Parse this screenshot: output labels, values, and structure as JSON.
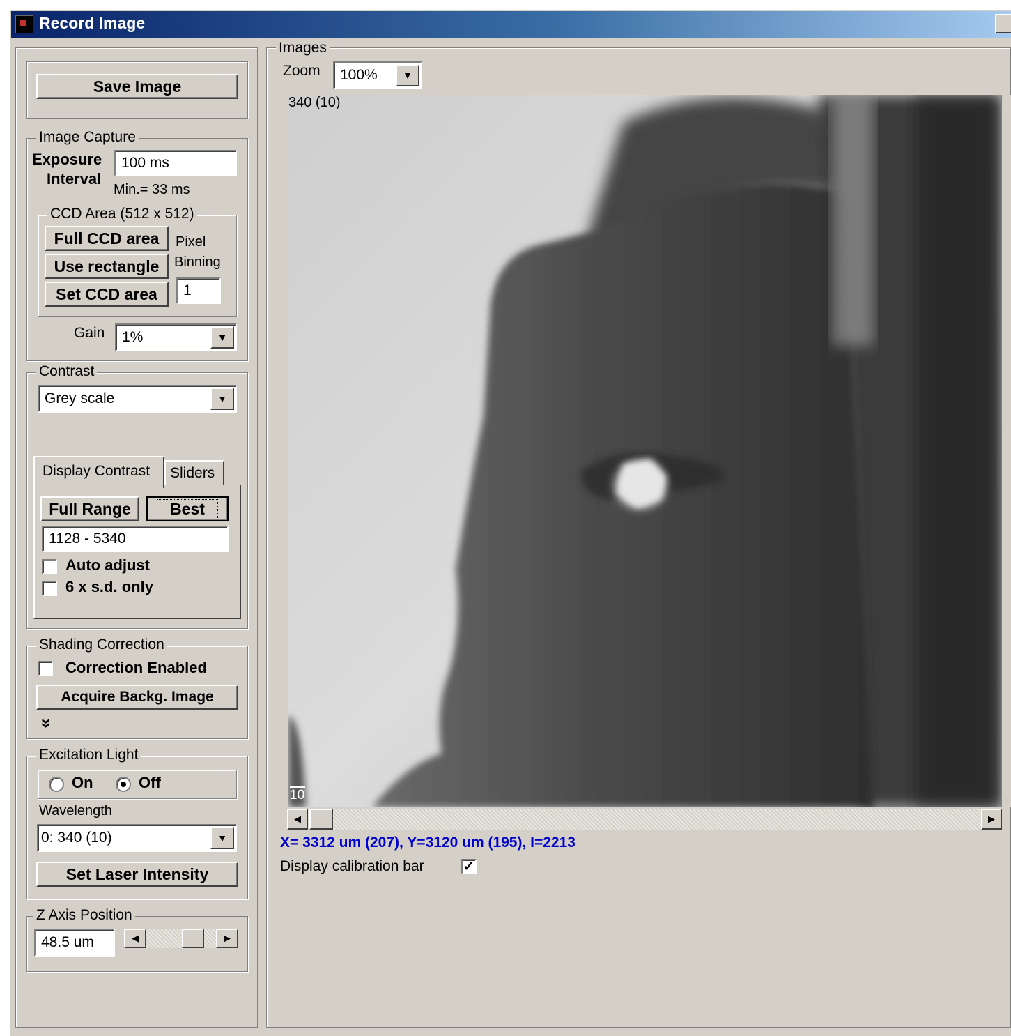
{
  "window": {
    "title": "Record Image"
  },
  "save_button": "Save Image",
  "image_capture": {
    "legend": "Image Capture",
    "exposure_label_1": "Exposure",
    "exposure_label_2": "Interval",
    "exposure_value": "100 ms",
    "min_note": "Min.= 33 ms",
    "ccd_area": {
      "legend": "CCD Area (512 x 512)",
      "full_button": "Full CCD area",
      "rect_button": "Use rectangle",
      "set_button": "Set CCD area",
      "binning_label_1": "Pixel",
      "binning_label_2": "Binning",
      "binning_value": "1"
    },
    "gain_label": "Gain",
    "gain_value": "1%"
  },
  "contrast": {
    "legend": "Contrast",
    "palette_value": "Grey scale",
    "tabs": [
      "Display Contrast",
      "Sliders"
    ],
    "full_range_button": "Full Range",
    "best_button": "Best",
    "range_value": "1128 - 5340",
    "auto_adjust_label": "Auto adjust",
    "auto_adjust_checked": false,
    "sd_only_label": "6 x s.d. only",
    "sd_only_checked": false
  },
  "shading": {
    "legend": "Shading Correction",
    "enabled_label": "Correction Enabled",
    "enabled_checked": false,
    "acquire_button": "Acquire Backg. Image",
    "expand_glyph": "»"
  },
  "excitation": {
    "legend": "Excitation Light",
    "on_label": "On",
    "off_label": "Off",
    "selected": "Off",
    "wavelength_label": "Wavelength",
    "wavelength_value": "0: 340 (10)",
    "laser_button": "Set Laser Intensity"
  },
  "z_axis": {
    "legend": "Z Axis Position",
    "value": "48.5 um",
    "slider_level": 0.5
  },
  "images": {
    "legend": "Images",
    "zoom_label": "Zoom",
    "zoom_value": "100%",
    "frame_label": "340 (10)",
    "calibration_label": "10",
    "readout": "X= 3312 um (207), Y=3120 um (195), I=2213",
    "display_calibration_label": "Display calibration bar",
    "display_calibration_checked": true
  },
  "colors": {
    "readout": "#0000cc",
    "title_start": "#0a246a",
    "title_end": "#a6caf0",
    "face": "#d4d0c8"
  }
}
